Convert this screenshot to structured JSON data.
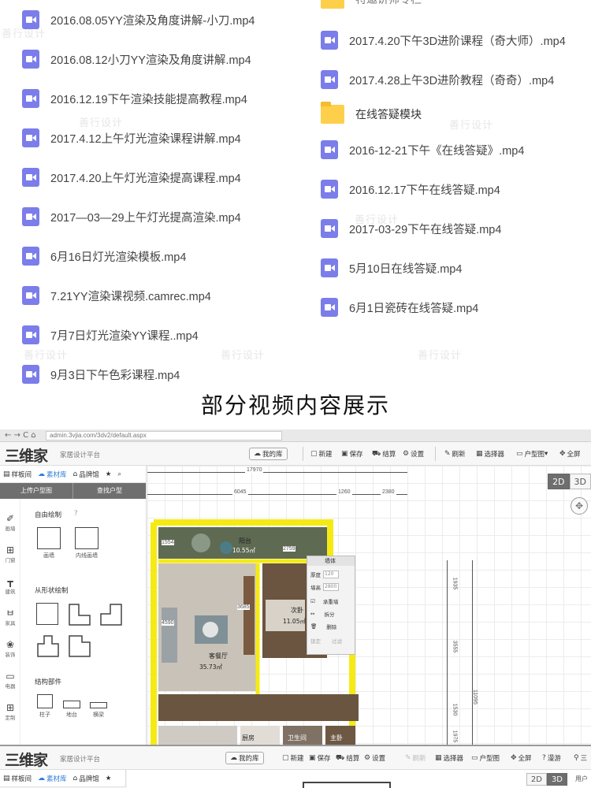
{
  "files_left": [
    "2016.08.05YY渲染及角度讲解-小刀.mp4",
    "2016.08.12小刀YY渲染及角度讲解.mp4",
    "2016.12.19下午渲染技能提高教程.mp4",
    "2017.4.12上午灯光渲染课程讲解.mp4",
    "2017.4.20上午灯光渲染提高课程.mp4",
    "2017—03—29上午灯光提高渲染.mp4",
    "6月16日灯光渲染模板.mp4",
    "7.21YY渲染课视频.camrec.mp4",
    "7月7日灯光渲染YY课程..mp4",
    "9月3日下午色彩课程.mp4"
  ],
  "folder_top_partial": "特邀讲师专栏",
  "files_right_a": [
    "2017.4.20下午3D进阶课程（奇大师）.mp4",
    "2017.4.28上午3D进阶教程（奇奇）.mp4"
  ],
  "folder_qa": "在线答疑模块",
  "files_right_b": [
    "2016-12-21下午《在线答疑》.mp4",
    "2016.12.17下午在线答疑.mp4",
    "2017-03-29下午在线答疑.mp4",
    "5月10日在线答疑.mp4",
    "6月1日瓷砖在线答疑.mp4"
  ],
  "watermark": "善行设计",
  "caption": "部分视频内容展示",
  "app": {
    "url": "admin.3vjia.com/3dv2/default.aspx",
    "browser_nav": "←  →  C  ⌂",
    "logo": "三维家",
    "logo_sub": "家居设计平台",
    "my_library": "我的库",
    "new": "新建",
    "save": "保存",
    "checkout": "结算",
    "settings": "设置",
    "brush": "刷新",
    "select": "选择器",
    "floorplan": "户型图",
    "fullscreen": "全屏",
    "tabs": [
      "样板间",
      "素材库",
      "品牌馆"
    ],
    "sub_upload": "上传户型图",
    "sub_find": "查找户型",
    "rail": [
      "画墙",
      "门窗",
      "建筑",
      "家具",
      "装饰",
      "电器",
      "定制"
    ],
    "free_draw": "自由绘制",
    "help": "?",
    "tool_wall": "画墙",
    "tool_inner_wall": "内线画墙",
    "shape_draw": "从形状绘制",
    "struct": "结构部件",
    "struct_items": [
      "柱子",
      "地台",
      "横梁"
    ],
    "view_2d": "2D",
    "view_3d": "3D",
    "dims": {
      "top_total": "17970",
      "seg1": "6045",
      "seg2": "1260",
      "seg3": "2380",
      "v1": "1935",
      "v2": "3555",
      "v3": "1530",
      "v4": "1975",
      "v_total": "11095",
      "d1": "1554",
      "d2": "2759",
      "d3": "3685",
      "d4": "4590"
    },
    "rooms": {
      "balcony": "阳台",
      "balcony_area": "10.55㎡",
      "living": "客餐厅",
      "living_area": "35.73㎡",
      "bedroom": "次卧",
      "bedroom_area": "11.05㎡",
      "kitchen": "厨房",
      "bath": "卫生间",
      "master": "主卧"
    },
    "wall_panel": {
      "title": "墙体",
      "thickness_label": "厚度",
      "thickness_value": "120",
      "height_label": "墙高",
      "height_value": "2800",
      "load_bearing": "承重墙",
      "split": "拆分",
      "delete": "删除",
      "lock": "锁定",
      "lock2": "过滤"
    }
  },
  "app2": {
    "logo": "三维家",
    "logo_sub": "家居设计平台",
    "my_library": "我的库",
    "new": "新建",
    "save": "保存",
    "checkout": "结算",
    "settings": "设置",
    "brush": "刷新",
    "select": "选择器",
    "floorplan": "户型图",
    "fullscreen": "全屏",
    "roam": "漫游",
    "three": "三",
    "tabs": [
      "样板间",
      "素材库",
      "品牌馆"
    ],
    "view_2d": "2D",
    "view_3d": "3D",
    "user": "用户"
  },
  "colors": {
    "video_icon": "#7b7dea",
    "folder_icon": "#fdcf4b",
    "accent_blue": "#2f7cd8",
    "wall_yellow": "#f5ea14"
  }
}
